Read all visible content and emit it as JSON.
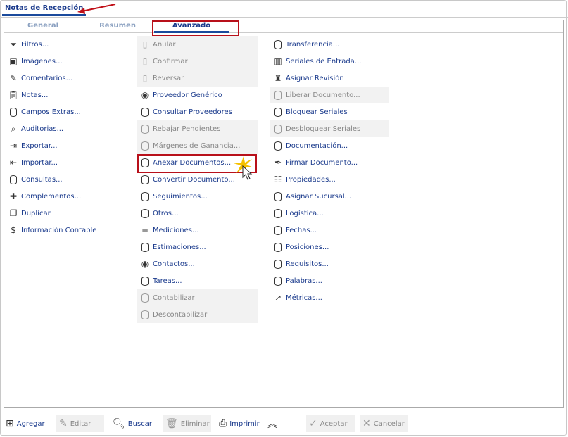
{
  "window_tab": "Notas de Recepción",
  "tabs": [
    {
      "label": "General"
    },
    {
      "label": "Resumen"
    },
    {
      "label": "Avanzado",
      "active": true
    }
  ],
  "columns": [
    [
      {
        "label": "Filtros...",
        "icon": "filter-icon"
      },
      {
        "label": "Imágenes...",
        "icon": "image-icon"
      },
      {
        "label": "Comentarios...",
        "icon": "comment-icon"
      },
      {
        "label": "Notas...",
        "icon": "clipboard-icon"
      },
      {
        "label": "Campos Extras...",
        "icon": "database-icon"
      },
      {
        "label": "Auditorias...",
        "icon": "audit-icon"
      },
      {
        "label": "Exportar...",
        "icon": "export-icon"
      },
      {
        "label": "Importar...",
        "icon": "import-icon"
      },
      {
        "label": "Consultas...",
        "icon": "database-icon"
      },
      {
        "label": "Complementos...",
        "icon": "puzzle-icon"
      },
      {
        "label": "Duplicar",
        "icon": "copy-icon"
      },
      {
        "label": "Información Contable",
        "icon": "dollar-icon"
      }
    ],
    [
      {
        "label": "Anular",
        "icon": "document-icon",
        "disabled": true
      },
      {
        "label": "Confirmar",
        "icon": "document-icon",
        "disabled": true
      },
      {
        "label": "Reversar",
        "icon": "document-icon",
        "disabled": true
      },
      {
        "label": "Proveedor Genérico",
        "icon": "user-icon"
      },
      {
        "label": "Consultar Proveedores",
        "icon": "database-icon"
      },
      {
        "label": "Rebajar Pendientes",
        "icon": "database-icon",
        "disabled": true
      },
      {
        "label": "Márgenes de Ganancia...",
        "icon": "database-icon",
        "disabled": true
      },
      {
        "label": "Anexar Documentos...",
        "icon": "database-icon",
        "highlight": true
      },
      {
        "label": "Convertir Documento...",
        "icon": "database-icon"
      },
      {
        "label": "Seguimientos...",
        "icon": "database-icon"
      },
      {
        "label": "Otros...",
        "icon": "database-icon"
      },
      {
        "label": "Mediciones...",
        "icon": "ruler-icon"
      },
      {
        "label": "Estimaciones...",
        "icon": "database-icon"
      },
      {
        "label": "Contactos...",
        "icon": "user-icon"
      },
      {
        "label": "Tareas...",
        "icon": "database-icon"
      },
      {
        "label": "Contabilizar",
        "icon": "database-icon",
        "disabled": true
      },
      {
        "label": "Descontabilizar",
        "icon": "database-icon",
        "disabled": true
      }
    ],
    [
      {
        "label": "Transferencia...",
        "icon": "database-icon"
      },
      {
        "label": "Seriales de Entrada...",
        "icon": "barcode-icon"
      },
      {
        "label": "Asignar Revisión",
        "icon": "stamp-icon"
      },
      {
        "label": "Liberar Documento...",
        "icon": "database-icon",
        "disabled": true
      },
      {
        "label": "Bloquear Seriales",
        "icon": "database-icon"
      },
      {
        "label": "Desbloquear Seriales",
        "icon": "database-icon",
        "disabled": true
      },
      {
        "label": "Documentación...",
        "icon": "database-icon"
      },
      {
        "label": "Firmar Documento...",
        "icon": "pen-icon"
      },
      {
        "label": "Propiedades...",
        "icon": "list-icon"
      },
      {
        "label": "Asignar Sucursal...",
        "icon": "database-icon"
      },
      {
        "label": "Logística...",
        "icon": "database-icon"
      },
      {
        "label": "Fechas...",
        "icon": "database-icon"
      },
      {
        "label": "Posiciones...",
        "icon": "database-icon"
      },
      {
        "label": "Requisitos...",
        "icon": "database-icon"
      },
      {
        "label": "Palabras...",
        "icon": "database-icon"
      },
      {
        "label": "Métricas...",
        "icon": "chart-icon"
      }
    ]
  ],
  "footer": {
    "agregar": "Agregar",
    "editar": "Editar",
    "buscar": "Buscar",
    "eliminar": "Eliminar",
    "imprimir": "Imprimir",
    "aceptar": "Aceptar",
    "cancelar": "Cancelar"
  },
  "colors": {
    "accent": "#1a3a8c",
    "highlight": "#b8101a"
  }
}
